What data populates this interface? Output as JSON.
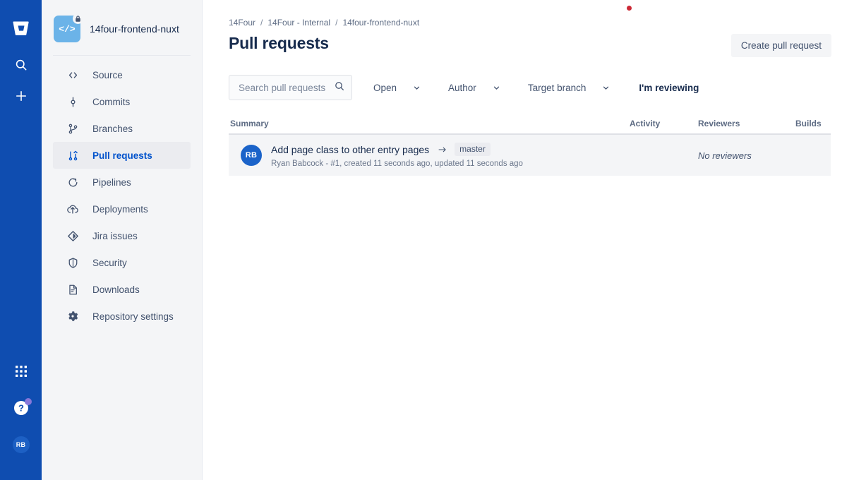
{
  "rail": {
    "logo_icon": "bitbucket-logo",
    "items": [
      {
        "name": "search-icon",
        "label": "Search"
      },
      {
        "name": "create-icon",
        "label": "Create"
      }
    ],
    "bottom_items": [
      {
        "name": "app-switcher-icon",
        "label": "App switcher"
      },
      {
        "name": "help-icon",
        "label": "Help"
      }
    ],
    "avatar_initials": "RB"
  },
  "sidebar": {
    "repo": {
      "name": "14four-frontend-nuxt",
      "avatar_glyph": "</>",
      "badge_icon": "lock-icon"
    },
    "items": [
      {
        "label": "Source",
        "icon": "code-icon",
        "active": false
      },
      {
        "label": "Commits",
        "icon": "commits-icon",
        "active": false
      },
      {
        "label": "Branches",
        "icon": "branches-icon",
        "active": false
      },
      {
        "label": "Pull requests",
        "icon": "pull-requests-icon",
        "active": true
      },
      {
        "label": "Pipelines",
        "icon": "pipelines-icon",
        "active": false
      },
      {
        "label": "Deployments",
        "icon": "deployments-icon",
        "active": false
      },
      {
        "label": "Jira issues",
        "icon": "jira-icon",
        "active": false
      },
      {
        "label": "Security",
        "icon": "shield-icon",
        "active": false
      },
      {
        "label": "Downloads",
        "icon": "downloads-icon",
        "active": false
      },
      {
        "label": "Repository settings",
        "icon": "gear-icon",
        "active": false
      }
    ]
  },
  "header": {
    "breadcrumb": [
      {
        "label": "14Four"
      },
      {
        "label": "14Four - Internal"
      },
      {
        "label": "14four-frontend-nuxt"
      }
    ],
    "breadcrumb_separator": "/",
    "title": "Pull requests",
    "create_button": "Create pull request"
  },
  "filters": {
    "search_placeholder": "Search pull requests",
    "search_value": "",
    "search_icon": "search-icon",
    "state_dropdown": "Open",
    "author_dropdown": "Author",
    "target_branch_dropdown": "Target branch",
    "reviewing_link": "I'm reviewing"
  },
  "table": {
    "columns": {
      "summary": "Summary",
      "activity": "Activity",
      "reviewers": "Reviewers",
      "builds": "Builds"
    },
    "rows": [
      {
        "avatar_initials": "RB",
        "title": "Add page class to other entry pages",
        "target_branch": "master",
        "meta": "Ryan Babcock - #1, created 11 seconds ago, updated 11 seconds ago",
        "activity": "",
        "reviewers": "No reviewers",
        "builds": ""
      }
    ]
  },
  "colors": {
    "rail_bg": "#0F4DB0",
    "sidebar_bg": "#F4F5F7",
    "accent": "#0052CC",
    "row_bg": "#F4F5F7",
    "notification_dot": "#CC2936",
    "help_badge": "#8777D9"
  }
}
